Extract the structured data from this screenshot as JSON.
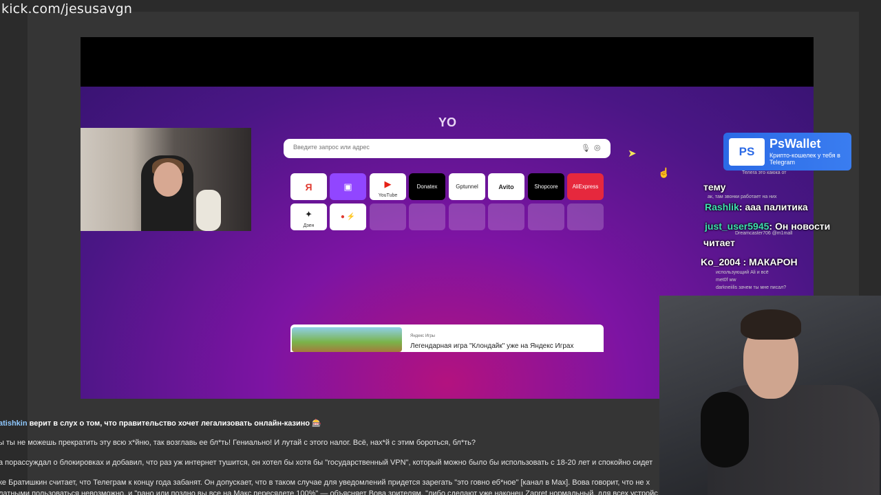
{
  "stream": {
    "watermark": "kick.com/jesusavgn"
  },
  "browser": {
    "logo": "YO",
    "search_placeholder": "Введите запрос или адрес",
    "tiles": [
      {
        "label": "Я",
        "sub": "",
        "style": "plain"
      },
      {
        "label": "▣",
        "sub": "",
        "style": "twitch"
      },
      {
        "label": "▶",
        "sub": "YouTube",
        "style": "plain"
      },
      {
        "label": "Donatex",
        "sub": "",
        "style": "dark"
      },
      {
        "label": "Gptunnel",
        "sub": "",
        "style": "plain"
      },
      {
        "label": "Avito",
        "sub": "",
        "style": "plain"
      },
      {
        "label": "Shopcore",
        "sub": "",
        "style": "dark"
      },
      {
        "label": "AliExpress",
        "sub": "",
        "style": "ali"
      },
      {
        "label": "✦",
        "sub": "Дзен",
        "style": "plain"
      },
      {
        "label": "● ⚡",
        "sub": "",
        "style": "plain"
      }
    ],
    "news": {
      "source": "Яндекс Игры",
      "title": "Легендарная игра \"Клондайк\" уже на Яндекс Играх"
    }
  },
  "ad": {
    "icon": "PS",
    "name": "PsWallet",
    "tagline": "Крипто-кошелек у тебя в Telegram"
  },
  "chat": {
    "lines": [
      {
        "user": "",
        "text": "тему"
      },
      {
        "user": "Rashlik",
        "text": ": ааа палитика"
      },
      {
        "user": "just_user5945",
        "text": ": Он новости"
      },
      {
        "user": "",
        "text": "читает"
      },
      {
        "user": "",
        "text": "Ko_2004 : МАКАРОН"
      }
    ],
    "small": [
      {
        "text": "Телега это каюка от"
      },
      {
        "text": "ак, там звонки работает на них"
      },
      {
        "text": "Dreamcaster706 @m1mall"
      },
      {
        "text": "использующий Ali и всё"
      },
      {
        "text": "met0f ww"
      },
      {
        "text": "darkneiilis зачем ты мне писал?"
      }
    ]
  },
  "feed": {
    "lines": [
      {
        "user": "atishkin",
        "text": " верит в слух о том, что правительство хочет легализовать онлайн-казино 🎰",
        "bold": true
      },
      {
        "user": "",
        "text": "ы ты не можешь прекратить эту всю х*йню, так возглавь ее бл*ть! Гениально! И лутай с этого налог. Всё, нах*й с этим бороться, бл*ть?",
        "bold": false
      },
      {
        "user": "",
        "text": "а порассуждал о блокировках и добавил, что раз уж интернет тушится, он хотел бы хотя бы \"государственный VPN\", который можно было бы использовать с 18-20 лет и спокойно сидет",
        "bold": false
      },
      {
        "user": "",
        "text": "ке Братишкин считает, что Телеграм к концу года забанят. Он допускает, что в таком случае для уведомлений придется зарегать \"это говно еб*ное\" [канал в Max]. Вова говорит, что не х",
        "bold": false
      },
      {
        "user": "",
        "text": "латными пользоваться невозможно, и \"рано или поздно вы все на Макс пересядете 100%\" — объясняет Вова зрителям. \"либо сделают уже наконец Zapret нормальный, для всех устройс",
        "bold": false
      }
    ]
  }
}
